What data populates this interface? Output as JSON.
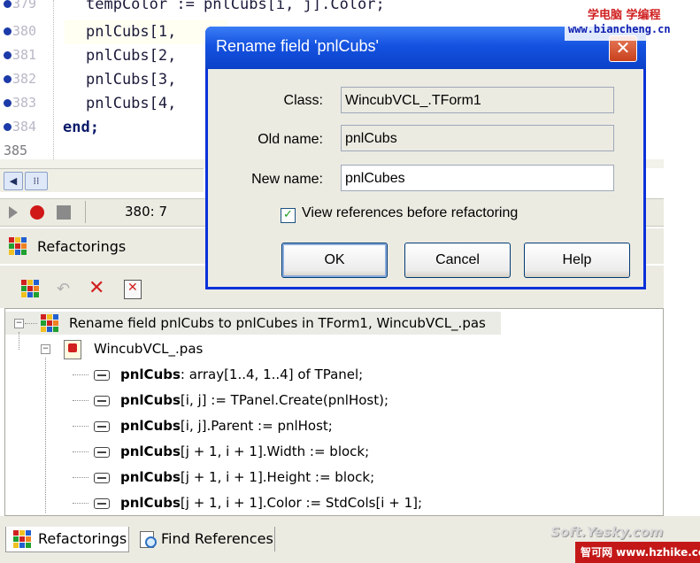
{
  "editor": {
    "gutter": [
      "379",
      "380",
      "381",
      "382",
      "383",
      "384",
      "385"
    ],
    "lines": [
      {
        "indent": "    ",
        "text": "tempColor := pnlCubs[i, j].Color;"
      },
      {
        "indent": "    ",
        "text": "pnlCubs[1,"
      },
      {
        "indent": "    ",
        "text": "pnlCubs[2,"
      },
      {
        "indent": "    ",
        "text": "pnlCubs[3,"
      },
      {
        "indent": "    ",
        "text": "pnlCubs[4,"
      },
      {
        "indent": "",
        "text": "end;"
      }
    ],
    "position": "380:  7"
  },
  "panel": {
    "title": "Refactorings",
    "tree": {
      "root": "Rename field pnlCubs to pnlCubes in TForm1, WincubVCL_.pas",
      "file": "WincubVCL_.pas",
      "items": [
        {
          "bold": "pnlCubs",
          "rest": ": array[1..4, 1..4] of TPanel;"
        },
        {
          "bold": "pnlCubs",
          "rest": "[i, j] := TPanel.Create(pnlHost);"
        },
        {
          "bold": "pnlCubs",
          "rest": "[i, j].Parent := pnlHost;"
        },
        {
          "bold": "pnlCubs",
          "rest": "[j + 1, i + 1].Width := block;"
        },
        {
          "bold": "pnlCubs",
          "rest": "[j + 1, i + 1].Height := block;"
        },
        {
          "bold": "pnlCubs",
          "rest": "[j + 1, i + 1].Color := StdCols[i + 1];"
        }
      ]
    }
  },
  "tabs": {
    "refactorings": "Refactorings",
    "find_references": "Find References"
  },
  "dialog": {
    "title": "Rename field 'pnlCubs'",
    "close_glyph": "✕",
    "class_label": "Class:",
    "class_value": "WincubVCL_.TForm1",
    "old_name_label": "Old name:",
    "old_name_value": "pnlCubs",
    "new_name_label": "New name:",
    "new_name_value": "pnlCubes",
    "checkbox_label": "View references before refactoring",
    "checkbox_checked": true,
    "ok": "OK",
    "cancel": "Cancel",
    "help": "Help"
  },
  "watermarks": {
    "top_line1": "学电脑 学编程",
    "top_line2": "www.biancheng.cn",
    "soft": "Soft.Yesky.com",
    "bottom": "智可网 www.hzhike.com"
  },
  "colors": {
    "titlebar": "#1452e0",
    "close_button": "#c8401c",
    "breakpoint": "#1c3aa8",
    "record": "#d01818"
  }
}
